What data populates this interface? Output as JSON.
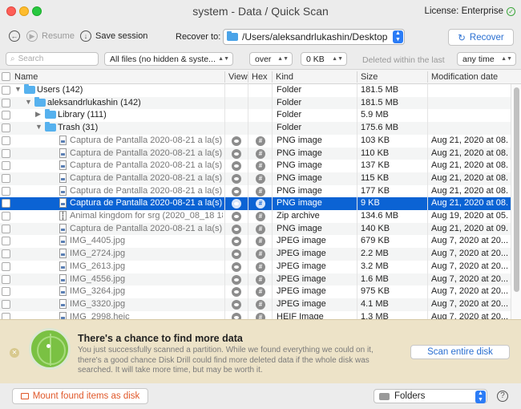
{
  "window": {
    "title": "system - Data / Quick Scan",
    "license": "License: Enterprise"
  },
  "toolbar": {
    "resume": "Resume",
    "save_session": "Save session",
    "recover_to_label": "Recover to:",
    "recover_path": "/Users/aleksandrlukashin/Desktop",
    "recover_button": "Recover"
  },
  "filters": {
    "search_placeholder": "Search",
    "file_filter": "All files (no hidden & syste...",
    "size_op": "over",
    "size_value": "0 KB",
    "deleted_label": "Deleted within the last",
    "time_range": "any time"
  },
  "columns": {
    "name": "Name",
    "view": "View",
    "hex": "Hex",
    "kind": "Kind",
    "size": "Size",
    "modified": "Modification date"
  },
  "rows": [
    {
      "name": "Users (142)",
      "kind": "Folder",
      "size": "181.5 MB",
      "date": ""
    },
    {
      "name": "aleksandrlukashin (142)",
      "kind": "Folder",
      "size": "181.5 MB",
      "date": ""
    },
    {
      "name": "Library (111)",
      "kind": "Folder",
      "size": "5.9 MB",
      "date": ""
    },
    {
      "name": "Trash (31)",
      "kind": "Folder",
      "size": "175.6 MB",
      "date": ""
    },
    {
      "name": "Captura de Pantalla 2020-08-21 a la(s)...",
      "kind": "PNG image",
      "size": "103 KB",
      "date": "Aug 21, 2020 at 08..."
    },
    {
      "name": "Captura de Pantalla 2020-08-21 a la(s)...",
      "kind": "PNG image",
      "size": "110 KB",
      "date": "Aug 21, 2020 at 08..."
    },
    {
      "name": "Captura de Pantalla 2020-08-21 a la(s)...",
      "kind": "PNG image",
      "size": "137 KB",
      "date": "Aug 21, 2020 at 08..."
    },
    {
      "name": "Captura de Pantalla 2020-08-21 a la(s)...",
      "kind": "PNG image",
      "size": "115 KB",
      "date": "Aug 21, 2020 at 08..."
    },
    {
      "name": "Captura de Pantalla 2020-08-21 a la(s)...",
      "kind": "PNG image",
      "size": "177 KB",
      "date": "Aug 21, 2020 at 08..."
    },
    {
      "name": "Captura de Pantalla 2020-08-21 a la(s)...",
      "kind": "PNG image",
      "size": "9 KB",
      "date": "Aug 21, 2020 at 08..."
    },
    {
      "name": "Animal kingdom for srg (2020_08_18 18_...",
      "kind": "Zip archive",
      "size": "134.6 MB",
      "date": "Aug 19, 2020 at 05..."
    },
    {
      "name": "Captura de Pantalla 2020-08-21 a la(s)...",
      "kind": "PNG image",
      "size": "140 KB",
      "date": "Aug 21, 2020 at 09..."
    },
    {
      "name": "IMG_4405.jpg",
      "kind": "JPEG image",
      "size": "679 KB",
      "date": "Aug 7, 2020 at 20..."
    },
    {
      "name": "IMG_2724.jpg",
      "kind": "JPEG image",
      "size": "2.2 MB",
      "date": "Aug 7, 2020 at 20..."
    },
    {
      "name": "IMG_2613.jpg",
      "kind": "JPEG image",
      "size": "3.2 MB",
      "date": "Aug 7, 2020 at 20..."
    },
    {
      "name": "IMG_4556.jpg",
      "kind": "JPEG image",
      "size": "1.6 MB",
      "date": "Aug 7, 2020 at 20..."
    },
    {
      "name": "IMG_3264.jpg",
      "kind": "JPEG image",
      "size": "975 KB",
      "date": "Aug 7, 2020 at 20..."
    },
    {
      "name": "IMG_3320.jpg",
      "kind": "JPEG image",
      "size": "4.1 MB",
      "date": "Aug 7, 2020 at 20..."
    },
    {
      "name": "IMG_2998.heic",
      "kind": "HEIF Image",
      "size": "1.3 MB",
      "date": "Aug 7, 2020 at 20..."
    }
  ],
  "banner": {
    "title": "There's a chance to find more data",
    "text": "You just successfully scanned a partition. While we found everything we could on it, there's a good chance Disk Drill could find more deleted data if the whole disk was searched. It will take more time, but may be worth it.",
    "scan_button": "Scan entire disk"
  },
  "footer": {
    "mount_button": "Mount found items as disk",
    "view_mode": "Folders",
    "help": "?"
  },
  "colors": {
    "accent": "#0b63d4",
    "link": "#2a6fd1",
    "mount": "#e0582a",
    "banner_bg": "#ede3c8"
  }
}
